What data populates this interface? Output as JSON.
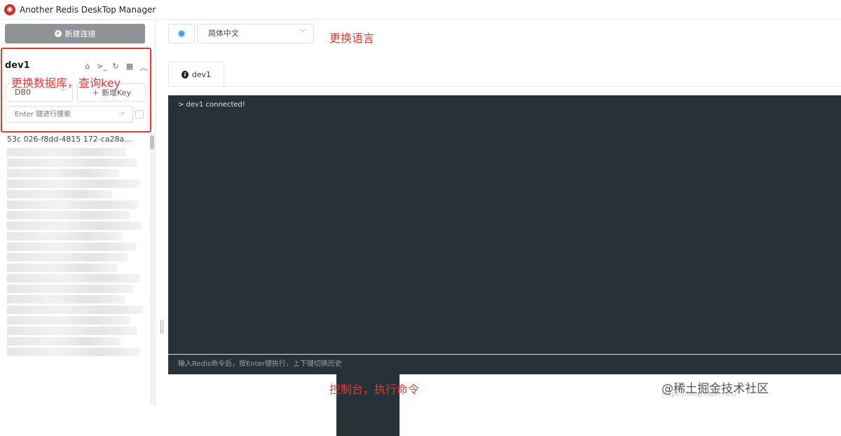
{
  "window": {
    "title": "Another Redis DeskTop Manager",
    "icon": "redis-logo-icon"
  },
  "sidebar": {
    "new_connection_label": "新建连接",
    "connection_name": "dev1",
    "tool_icons": [
      "home-icon",
      "terminal-icon",
      "refresh-icon",
      "grid-icon",
      "chevron-up-icon"
    ],
    "db_select_value": "DB0",
    "add_key_label": "新增Key",
    "search_placeholder": "Enter 键进行搜索",
    "keys": [
      "53c  026-f8dd-4815  172-ca28a..."
    ],
    "annotation": "更换数据库，查询key"
  },
  "toolbar": {
    "language_value": "简体中文",
    "annotation": "更换语言"
  },
  "tabs": [
    {
      "label": "dev1",
      "icon": "info-icon"
    },
    {
      "label": "dev1",
      "icon": "terminal-prompt-icon",
      "active": true
    }
  ],
  "console": {
    "output": "> dev1 connected!",
    "input_placeholder": "输入Redis命令后，按Enter键执行，上下键切换历史",
    "annotation": "控制台，执行命令"
  },
  "watermark": {
    "text": "@稀土掘金技术社区",
    "faint": "https://blog.csdn.net/"
  },
  "colors": {
    "accent": "#409eff",
    "annotation": "#e53935",
    "console_bg": "#263238",
    "button_gray": "#8f9296"
  }
}
